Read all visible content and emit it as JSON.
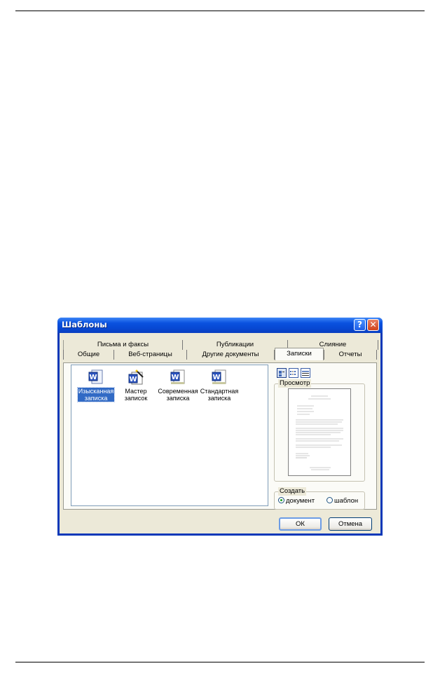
{
  "window": {
    "title": "Шаблоны",
    "help_glyph": "?",
    "close_glyph": "✕"
  },
  "tabs_row1": [
    "Письма и факсы",
    "Публикации",
    "Слияние"
  ],
  "tabs_row2": [
    "Общие",
    "Веб-страницы",
    "Другие документы",
    "Записки",
    "Отчеты"
  ],
  "active_tab": "Записки",
  "templates": [
    {
      "label_l1": "Изысканная",
      "label_l2": "записка",
      "icon": "word-document-icon",
      "selected": true
    },
    {
      "label_l1": "Мастер",
      "label_l2": "записок",
      "icon": "word-wizard-icon",
      "selected": false
    },
    {
      "label_l1": "Современная",
      "label_l2": "записка",
      "icon": "word-document-icon",
      "selected": false
    },
    {
      "label_l1": "Стандартная",
      "label_l2": "записка",
      "icon": "word-document-icon",
      "selected": false
    }
  ],
  "view_buttons": [
    "large-icons-view-icon",
    "list-view-icon",
    "details-view-icon"
  ],
  "preview": {
    "label": "Просмотр"
  },
  "create": {
    "label": "Создать",
    "options": [
      {
        "label": "документ",
        "checked": true
      },
      {
        "label": "шаблон",
        "checked": false
      }
    ]
  },
  "buttons": {
    "ok": "ОК",
    "cancel": "Отмена"
  },
  "colors": {
    "title_bar": "#0a52e0",
    "selection": "#316ac5",
    "dialog_face": "#ece9d8"
  }
}
